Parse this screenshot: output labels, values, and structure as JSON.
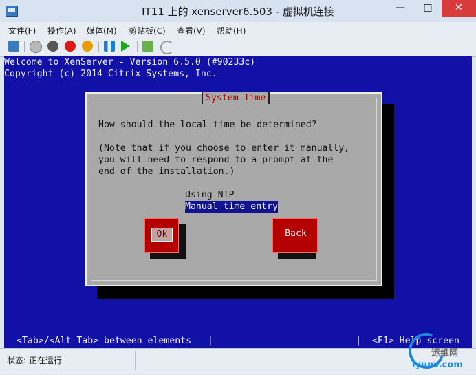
{
  "window": {
    "title": "IT11 上的 xenserver6.503 - 虚拟机连接",
    "minimize": "—",
    "maximize": "□",
    "close": "✕"
  },
  "menu": {
    "items": [
      "文件(F)",
      "操作(A)",
      "媒体(M)",
      "剪贴板(C)",
      "查看(V)",
      "帮助(H)"
    ]
  },
  "toolbar": {
    "icons": [
      "connect-icon",
      "start-icon",
      "stop-icon",
      "reset-icon",
      "power-icon",
      "pause-icon",
      "resume-icon",
      "snapshot-icon",
      "revert-icon"
    ]
  },
  "console": {
    "welcome_line": "Welcome to XenServer - Version 6.5.0 (#90233c)",
    "copyright_line": "Copyright (c) 2014 Citrix Systems, Inc.",
    "dialog": {
      "title": "System Time",
      "question": "How should the local time be determined?",
      "note_line1": "(Note that if you choose to enter it manually,",
      "note_line2": "you will need to respond to a prompt at the",
      "note_line3": "end of the installation.)",
      "options": [
        "Using NTP",
        "Manual time entry"
      ],
      "ok_label": "Ok",
      "back_label": "Back"
    },
    "bottom_left": "<Tab>/<Alt-Tab> between elements   |",
    "bottom_right": "|  <F1> Help screen"
  },
  "statusbar": {
    "text": "状态: 正在运行"
  },
  "watermark": {
    "text": "运维网",
    "domain": "iyunv.com"
  },
  "colors": {
    "console_blue": "#1111a8",
    "dialog_gray": "#a9a9a9",
    "button_red": "#b50000",
    "selection_blue": "#111194"
  }
}
